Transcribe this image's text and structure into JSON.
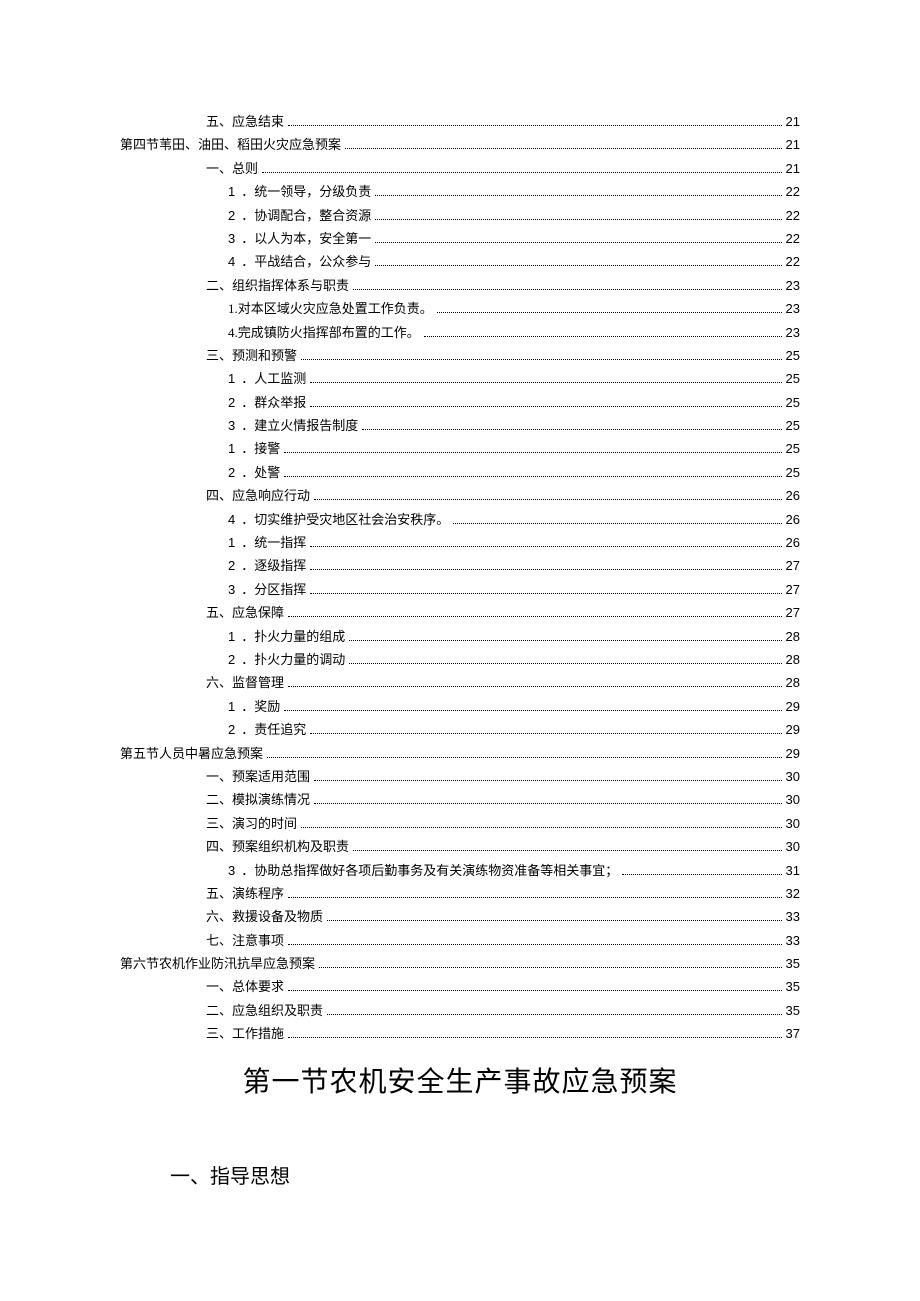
{
  "toc": [
    {
      "indent": 2,
      "num": "",
      "label": "五、应急结束",
      "page": "21"
    },
    {
      "indent": 0,
      "num": "",
      "label": "第四节苇田、油田、稻田火灾应急预案",
      "page": "21"
    },
    {
      "indent": 2,
      "num": "",
      "label": "一、总则",
      "page": "21"
    },
    {
      "indent": 3,
      "num": "1",
      "label": "．统一领导，分级负责",
      "page": "22"
    },
    {
      "indent": 3,
      "num": "2",
      "label": "．协调配合，整合资源",
      "page": "22"
    },
    {
      "indent": 3,
      "num": "3",
      "label": "．以人为本，安全第一",
      "page": "22"
    },
    {
      "indent": 3,
      "num": "4",
      "label": "．平战结合，公众参与",
      "page": "22"
    },
    {
      "indent": 2,
      "num": "",
      "label": "二、组织指挥体系与职责",
      "page": "23"
    },
    {
      "indent": 3,
      "num": "",
      "label": "1.对本区域火灾应急处置工作负责。",
      "page": "23"
    },
    {
      "indent": 3,
      "num": "",
      "label": "4.完成镇防火指挥部布置的工作。",
      "page": "23"
    },
    {
      "indent": 2,
      "num": "",
      "label": "三、预测和预警",
      "page": "25"
    },
    {
      "indent": 3,
      "num": "1",
      "label": "．人工监测",
      "page": "25"
    },
    {
      "indent": 3,
      "num": "2",
      "label": "．群众举报",
      "page": "25"
    },
    {
      "indent": 3,
      "num": "3",
      "label": "．建立火情报告制度",
      "page": "25"
    },
    {
      "indent": 3,
      "num": "1",
      "label": "．接警",
      "page": "25"
    },
    {
      "indent": 3,
      "num": "2",
      "label": "．处警",
      "page": "25"
    },
    {
      "indent": 2,
      "num": "",
      "label": "四、应急响应行动",
      "page": "26"
    },
    {
      "indent": 3,
      "num": "4",
      "label": "．切实维护受灾地区社会治安秩序。",
      "page": "26"
    },
    {
      "indent": 3,
      "num": "1",
      "label": "．统一指挥",
      "page": "26"
    },
    {
      "indent": 3,
      "num": "2",
      "label": "．逐级指挥",
      "page": "27"
    },
    {
      "indent": 3,
      "num": "3",
      "label": "．分区指挥",
      "page": "27"
    },
    {
      "indent": 2,
      "num": "",
      "label": "五、应急保障",
      "page": "27"
    },
    {
      "indent": 3,
      "num": "1",
      "label": "．扑火力量的组成",
      "page": "28"
    },
    {
      "indent": 3,
      "num": "2",
      "label": "．扑火力量的调动",
      "page": "28"
    },
    {
      "indent": 2,
      "num": "",
      "label": "六、监督管理",
      "page": "28"
    },
    {
      "indent": 3,
      "num": "1",
      "label": "．奖励",
      "page": "29"
    },
    {
      "indent": 3,
      "num": "2",
      "label": "．责任追究",
      "page": "29"
    },
    {
      "indent": 0,
      "num": "",
      "label": "第五节人员中暑应急预案",
      "page": "29"
    },
    {
      "indent": 2,
      "num": "",
      "label": "一、预案适用范围",
      "page": "30"
    },
    {
      "indent": 2,
      "num": "",
      "label": "二、模拟演练情况",
      "page": "30"
    },
    {
      "indent": 2,
      "num": "",
      "label": "三、演习的时间",
      "page": "30"
    },
    {
      "indent": 2,
      "num": "",
      "label": "四、预案组织机构及职责",
      "page": "30"
    },
    {
      "indent": 3,
      "num": "3",
      "label": "．协助总指挥做好各项后勤事务及有关演练物资准备等相关事宜；",
      "page": "31"
    },
    {
      "indent": 2,
      "num": "",
      "label": "五、演练程序",
      "page": "32"
    },
    {
      "indent": 2,
      "num": "",
      "label": "六、救援设备及物质",
      "page": "33"
    },
    {
      "indent": 2,
      "num": "",
      "label": "七、注意事项",
      "page": "33"
    },
    {
      "indent": 0,
      "num": "",
      "label": "第六节农机作业防汛抗旱应急预案",
      "page": "35"
    },
    {
      "indent": 2,
      "num": "",
      "label": "一、总体要求",
      "page": "35"
    },
    {
      "indent": 2,
      "num": "",
      "label": "二、应急组织及职责",
      "page": "35"
    },
    {
      "indent": 2,
      "num": "",
      "label": "三、工作措施",
      "page": "37"
    }
  ],
  "chapter_title": "第一节农机安全生产事故应急预案",
  "section_heading": "一、指导思想"
}
